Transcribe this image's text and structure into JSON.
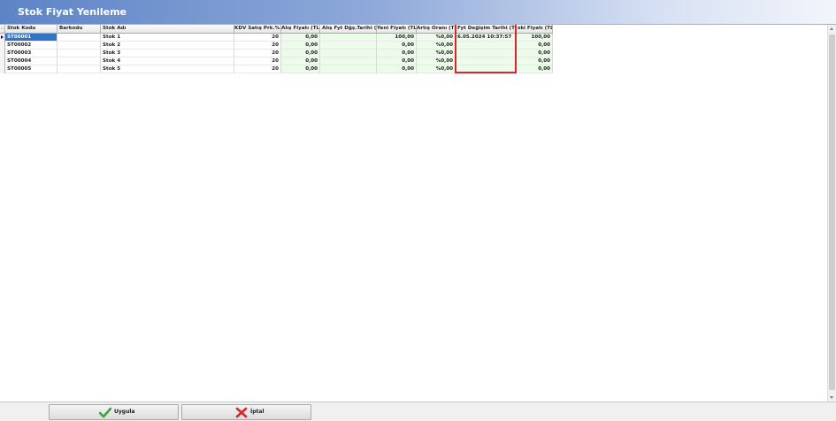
{
  "window": {
    "title": "Stok Fiyat Yenileme"
  },
  "grid": {
    "indicator_header": "::",
    "columns": [
      {
        "label": "Stok Kodu"
      },
      {
        "label": "Barkodu"
      },
      {
        "label": "Stok Adı"
      },
      {
        "label": "KDV Satış Prk.%"
      },
      {
        "label": "Alış Fiyatı (TL)"
      },
      {
        "label": "Alış Fyt Dğş.Tarihi (TL)"
      },
      {
        "label": "Yeni Fiyatı (TL)"
      },
      {
        "label": "Artış Oranı (TL)"
      },
      {
        "label": "Fyt Değişim Tarihi (TL)"
      },
      {
        "label": "ski Fiyatı (TL)"
      }
    ],
    "rows": [
      [
        "ST00001",
        "",
        "Stok 1",
        "20",
        "0,00",
        "",
        "100,00",
        "%0,00",
        "6.05.2024 10:37:57",
        "100,00"
      ],
      [
        "ST00002",
        "",
        "Stok 2",
        "20",
        "0,00",
        "",
        "0,00",
        "%0,00",
        "",
        "0,00"
      ],
      [
        "ST00003",
        "",
        "Stok 3",
        "20",
        "0,00",
        "",
        "0,00",
        "%0,00",
        "",
        "0,00"
      ],
      [
        "ST00004",
        "",
        "Stok 4",
        "20",
        "0,00",
        "",
        "0,00",
        "%0,00",
        "",
        "0,00"
      ],
      [
        "ST00005",
        "",
        "Stok 5",
        "20",
        "0,00",
        "",
        "0,00",
        "%0,00",
        "",
        "0,00"
      ]
    ],
    "selected_row": 0
  },
  "buttons": {
    "ok_label": "Uygula",
    "cancel_label": "İptal"
  },
  "colors": {
    "title_gradient_start": "#5d84c6",
    "selection": "#2f74c6",
    "editable_cell": "#ecfbea",
    "highlight_box": "#d8242a",
    "ok_icon": "#3aa33a",
    "cancel_icon": "#d7262c"
  },
  "icons": {
    "ok": "checkmark-icon",
    "cancel": "cross-icon"
  }
}
